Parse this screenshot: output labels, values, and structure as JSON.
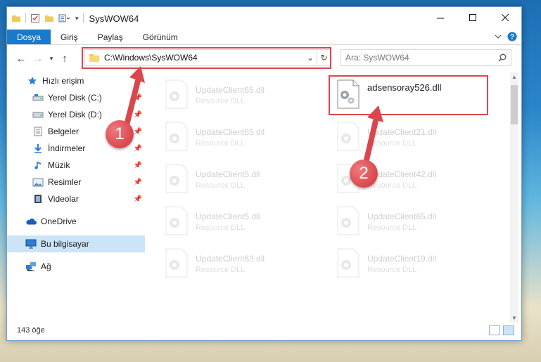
{
  "window": {
    "title": "SysWOW64",
    "minimize_icon": "minimize-icon",
    "maximize_icon": "maximize-icon",
    "close_icon": "close-icon"
  },
  "ribbon": {
    "tabs": [
      {
        "label": "Dosya",
        "active": true
      },
      {
        "label": "Giriş",
        "active": false
      },
      {
        "label": "Paylaş",
        "active": false
      },
      {
        "label": "Görünüm",
        "active": false
      }
    ]
  },
  "nav": {
    "address": "C:\\Windows\\SysWOW64",
    "search_placeholder": "Ara: SysWOW64"
  },
  "sidebar": {
    "items": [
      {
        "label": "Hızlı erişim",
        "icon": "star-icon",
        "pinned": false
      },
      {
        "label": "Yerel Disk (C:)",
        "icon": "drive-icon",
        "pinned": true
      },
      {
        "label": "Yerel Disk (D:)",
        "icon": "drive-icon",
        "pinned": true
      },
      {
        "label": "Belgeler",
        "icon": "documents-icon",
        "pinned": true
      },
      {
        "label": "İndirmeler",
        "icon": "download-icon",
        "pinned": true
      },
      {
        "label": "Müzik",
        "icon": "music-icon",
        "pinned": true
      },
      {
        "label": "Resimler",
        "icon": "pictures-icon",
        "pinned": true
      },
      {
        "label": "Videolar",
        "icon": "video-icon",
        "pinned": true
      },
      {
        "label": "OneDrive",
        "icon": "cloud-icon",
        "pinned": false
      },
      {
        "label": "Bu bilgisayar",
        "icon": "computer-icon",
        "pinned": false,
        "selected": true
      },
      {
        "label": "Ağ",
        "icon": "network-icon",
        "pinned": false
      }
    ]
  },
  "files": {
    "highlighted": {
      "name": "adsensoray526.dll",
      "type": ""
    },
    "faded": [
      {
        "name": "UpdateClient65.dll",
        "type": "Resource DLL"
      },
      {
        "name": "UpdateClient65.dll",
        "type": "Resource DLL"
      },
      {
        "name": "UpdateClient21.dll",
        "type": "Resource DLL"
      },
      {
        "name": "UpdateClient5.dll",
        "type": "Resource DLL"
      },
      {
        "name": "UpdateClient42.dll",
        "type": "Resource DLL"
      },
      {
        "name": "UpdateClient5.dll",
        "type": "Resource DLL"
      },
      {
        "name": "UpdateClient65.dll",
        "type": "Resource DLL"
      },
      {
        "name": "UpdateClient63.dll",
        "type": "Resource DLL"
      },
      {
        "name": "UpdateClient19.dll",
        "type": "Resource DLL"
      }
    ]
  },
  "status": {
    "item_count": "143 öğe"
  },
  "annotations": {
    "step1": "1",
    "step2": "2",
    "color": "#d9474c"
  }
}
